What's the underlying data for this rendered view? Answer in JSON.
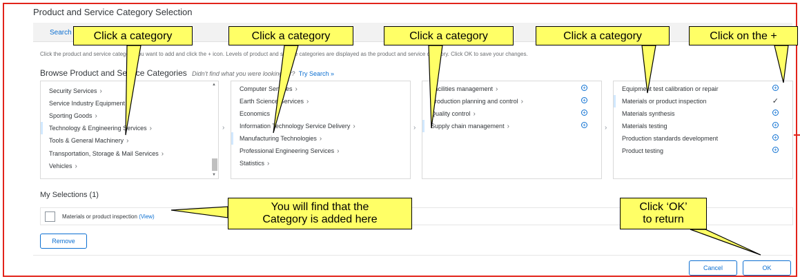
{
  "dialog": {
    "title": "Product and Service Category Selection",
    "tab_search": "Search",
    "instructions": "Click the product and service category you want to add and click the + icon. Levels of product and service categories are displayed as the product and service category. Click OK to save your changes.",
    "browse_title": "Browse Product and Service Categories",
    "browse_hint": "Didn't find what you were looking for?",
    "try_search": "Try Search »"
  },
  "columns": {
    "col1": [
      "Security Services",
      "Service Industry Equipment",
      "Sporting Goods",
      "Technology & Engineering Services",
      "Tools & General Machinery",
      "Transportation, Storage & Mail Services",
      "Vehicles"
    ],
    "col2": [
      "Computer Services",
      "Earth Science Services",
      "Economics",
      "Information Technology Service Delivery",
      "Manufacturing Technologies",
      "Professional Engineering Services",
      "Statistics"
    ],
    "col3": [
      "Facilities management",
      "Production planning and control",
      "Quality control",
      "Supply chain management"
    ],
    "col4": [
      "Equipment test calibration or repair",
      "Materials or product inspection",
      "Materials synthesis",
      "Materials testing",
      "Production standards development",
      "Product testing"
    ]
  },
  "selections": {
    "heading": "My Selections (1)",
    "items": [
      {
        "label": "Materials or product inspection",
        "view_link": "(View)"
      }
    ]
  },
  "buttons": {
    "remove": "Remove",
    "cancel": "Cancel",
    "ok": "OK"
  },
  "callouts": {
    "c1": "Click a category",
    "c2": "Click a category",
    "c3": "Click a category",
    "c4": "Click a category",
    "c5": "Click on the +",
    "c6_line1": "You will find that the",
    "c6_line2": "Category is added here",
    "c7_line1": "Click ‘OK’",
    "c7_line2": "to return"
  },
  "icons": {
    "chevron": "chevron-right-icon",
    "add": "add-circle-icon",
    "check": "check-icon"
  },
  "colors": {
    "accent": "#0a6ed1",
    "callout_fill": "#ffff66",
    "frame_border": "#e2231a"
  }
}
